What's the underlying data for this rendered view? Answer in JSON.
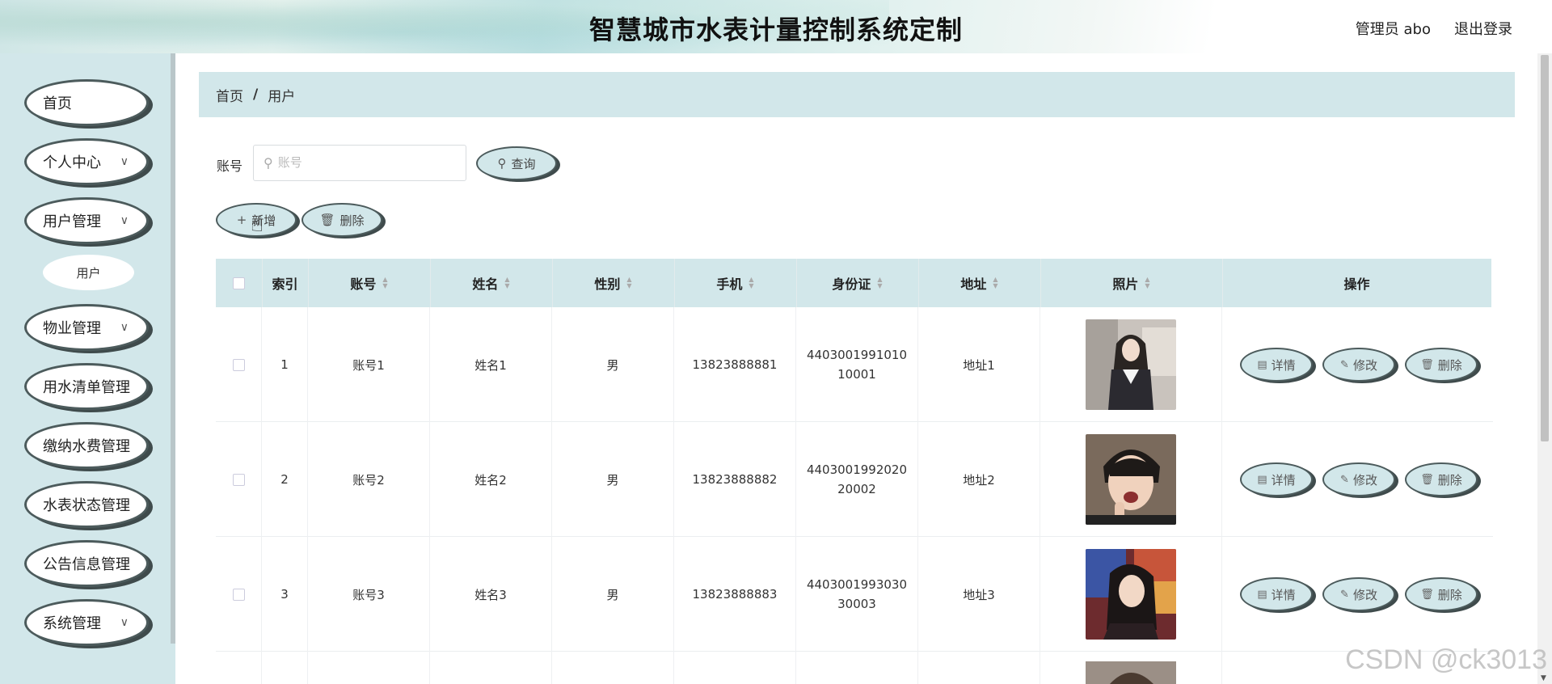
{
  "header": {
    "title": "智慧城市水表计量控制系统定制",
    "user_label": "管理员 abo",
    "logout_label": "退出登录"
  },
  "sidebar": {
    "items": [
      {
        "label": "首页",
        "has_arrow": false
      },
      {
        "label": "个人中心",
        "has_arrow": true
      },
      {
        "label": "用户管理",
        "has_arrow": true
      },
      {
        "label": "物业管理",
        "has_arrow": true
      },
      {
        "label": "用水清单管理",
        "has_arrow": false
      },
      {
        "label": "缴纳水费管理",
        "has_arrow": false
      },
      {
        "label": "水表状态管理",
        "has_arrow": false
      },
      {
        "label": "公告信息管理",
        "has_arrow": false
      },
      {
        "label": "系统管理",
        "has_arrow": true
      }
    ],
    "sub_item": "用户"
  },
  "breadcrumb": {
    "home": "首页",
    "separator": "/",
    "current": "用户"
  },
  "search": {
    "label": "账号",
    "placeholder": "账号",
    "value": "",
    "query_label": "查询"
  },
  "toolbar": {
    "add_label": "新增",
    "delete_label": "删除"
  },
  "table": {
    "columns": {
      "index": "索引",
      "account": "账号",
      "name": "姓名",
      "gender": "性别",
      "phone": "手机",
      "idcard": "身份证",
      "address": "地址",
      "photo": "照片",
      "action": "操作"
    },
    "rows": [
      {
        "index": "1",
        "account": "账号1",
        "name": "姓名1",
        "gender": "男",
        "phone": "13823888881",
        "idcard_line1": "4403001991010",
        "idcard_line2": "10001",
        "address": "地址1"
      },
      {
        "index": "2",
        "account": "账号2",
        "name": "姓名2",
        "gender": "男",
        "phone": "13823888882",
        "idcard_line1": "4403001992020",
        "idcard_line2": "20002",
        "address": "地址2"
      },
      {
        "index": "3",
        "account": "账号3",
        "name": "姓名3",
        "gender": "男",
        "phone": "13823888883",
        "idcard_line1": "4403001993030",
        "idcard_line2": "30003",
        "address": "地址3"
      }
    ],
    "actions": {
      "detail": "详情",
      "edit": "修改",
      "delete": "删除"
    }
  },
  "watermark": "CSDN @ck3013",
  "colors": {
    "accent": "#d2e7ea",
    "border_dark": "#4c5b5c"
  }
}
